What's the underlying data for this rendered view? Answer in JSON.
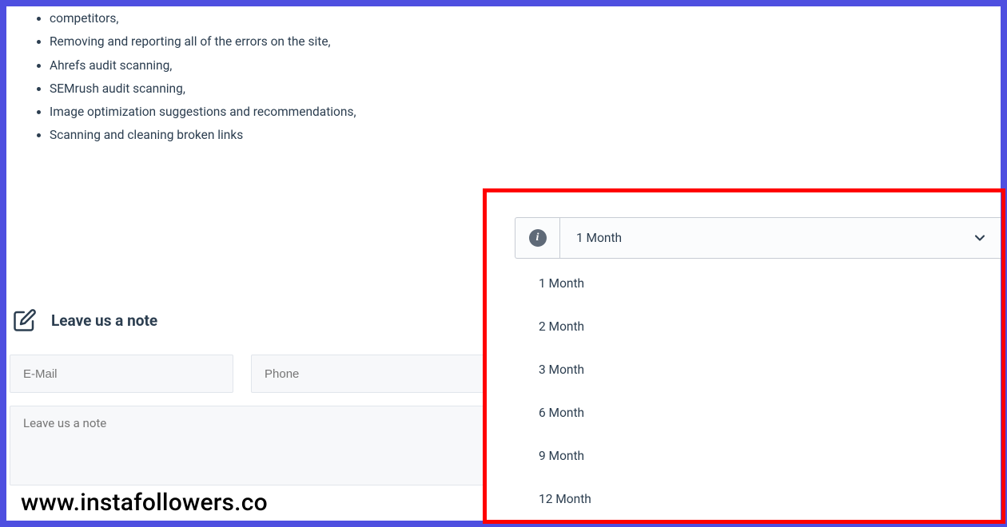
{
  "content_partial": "competitors,",
  "bullets": [
    "Removing and reporting all of the errors on the site,",
    "Ahrefs audit scanning,",
    "SEMrush audit scanning,",
    "Image optimization suggestions and recommendations,",
    "Scanning and cleaning broken links"
  ],
  "note": {
    "title": "Leave us a note",
    "email_placeholder": "E-Mail",
    "phone_placeholder": "Phone",
    "textarea_placeholder": "Leave us a note"
  },
  "dropdown": {
    "selected": "1 Month",
    "options": [
      "1 Month",
      "2 Month",
      "3 Month",
      "6 Month",
      "9 Month",
      "12 Month"
    ]
  },
  "watermark": "www.instafollowers.co"
}
